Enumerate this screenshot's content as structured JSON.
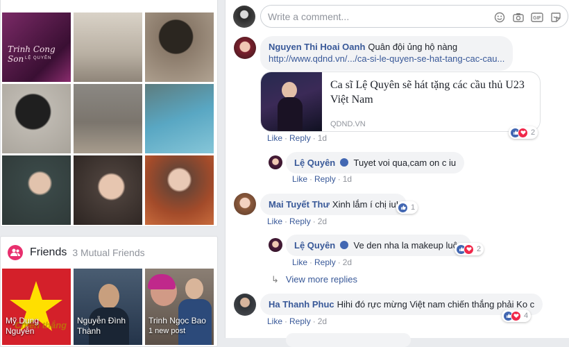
{
  "friends": {
    "title": "Friends",
    "count": "3 Mutual Friends",
    "tiles": [
      {
        "name": "Mỹ Dung\nNguyễn",
        "bg": "#d3202a",
        "overlay": "Chiến thắng"
      },
      {
        "name": "Nguyễn Đình\nThành",
        "bg": "#334b6c"
      },
      {
        "name": "Trinh Ngọc Bao",
        "sub": "1 new post",
        "bg": "#7b6d63"
      }
    ]
  },
  "photos": {
    "album_text": "Trinh Cong Son",
    "album_sub": "LỆ QUYÊN",
    "colors": [
      "#5a1f4f",
      "#cfc7bd",
      "#8a7a6a",
      "#b9b5ae",
      "#7d786f",
      "#4d8da0",
      "#3c4b4a",
      "#4b3f3a",
      "#a34b2a"
    ]
  },
  "composer": {
    "placeholder": "Write a comment...",
    "icons": [
      "emoji-icon",
      "camera-icon",
      "gif-icon",
      "sticker-icon"
    ]
  },
  "comments": [
    {
      "author": "Nguyen Thi Hoai Oanh",
      "text": "Quân đội ủng hộ nàng",
      "link_text": "http://www.qdnd.vn/.../ca-si-le-quyen-se-hat-tang-cac-cau...",
      "preview": {
        "title": "Ca sĩ Lệ Quyên sẽ hát tặng các cầu thủ U23 Việt Nam",
        "domain": "QDND.VN"
      },
      "reactions": "2",
      "like": "Like",
      "reply": "Reply",
      "time": "1d"
    },
    {
      "author": "Lệ Quyên",
      "text": "Tuyet voi qua,cam on c iu",
      "like": "Like",
      "reply": "Reply",
      "time": "1d"
    },
    {
      "author": "Mai Tuyết Thư",
      "text": "Xinh lắm í chị iu!",
      "reactions": "1",
      "like": "Like",
      "reply": "Reply",
      "time": "2d"
    },
    {
      "author": "Lệ Quyên",
      "text": "Ve den nha la makeup luôn",
      "reactions": "2",
      "like": "Like",
      "reply": "Reply",
      "time": "2d"
    },
    {
      "author": "Ha Thanh Phuc",
      "text": "Hihi đó rực mừng Việt nam chiến thắng phải Ko c",
      "reactions": "4",
      "like": "Like",
      "reply": "Reply",
      "time": "2d"
    }
  ],
  "view_more": "View more replies",
  "dot": "·"
}
